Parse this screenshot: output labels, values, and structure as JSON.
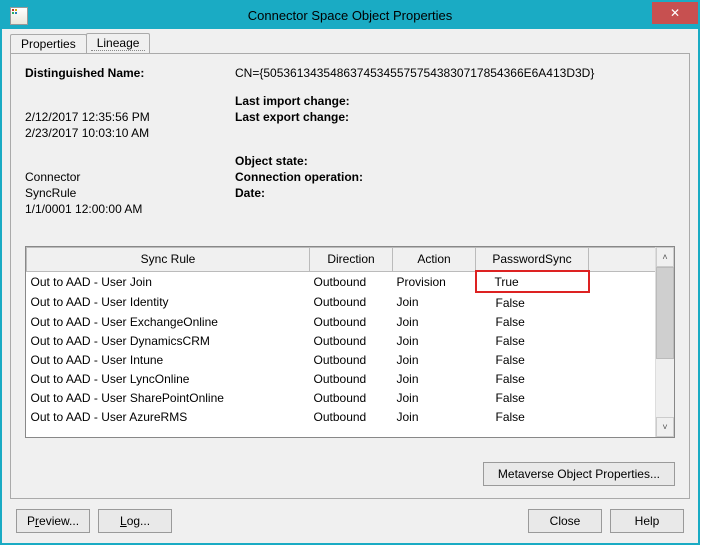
{
  "window": {
    "title": "Connector Space Object Properties",
    "close_tooltip": "Close"
  },
  "tabs": {
    "properties_label": "Properties",
    "lineage_label": "Lineage",
    "active": "lineage"
  },
  "fields": {
    "dn_label": "Distinguished Name:",
    "dn_value": "CN={505361343548637453455757543830717854366E6A413D3D}",
    "last_import_label": "Last import change:",
    "last_import_value": "2/12/2017 12:35:56 PM",
    "last_export_label": "Last export change:",
    "last_export_value": "2/23/2017 10:03:10 AM",
    "object_state_label": "Object state:",
    "object_state_value": "Connector",
    "conn_op_label": "Connection operation:",
    "conn_op_value": "SyncRule",
    "date_label": "Date:",
    "date_value": "1/1/0001 12:00:00 AM"
  },
  "table": {
    "columns": {
      "sync_rule": "Sync Rule",
      "direction": "Direction",
      "action": "Action",
      "password_sync": "PasswordSync"
    },
    "rows": [
      {
        "rule": "Out to AAD - User Join",
        "dir": "Outbound",
        "action": "Provision",
        "pw": "True",
        "hl": true
      },
      {
        "rule": "Out to AAD - User Identity",
        "dir": "Outbound",
        "action": "Join",
        "pw": "False",
        "hl": false
      },
      {
        "rule": "Out to AAD - User ExchangeOnline",
        "dir": "Outbound",
        "action": "Join",
        "pw": "False",
        "hl": false
      },
      {
        "rule": "Out to AAD - User DynamicsCRM",
        "dir": "Outbound",
        "action": "Join",
        "pw": "False",
        "hl": false
      },
      {
        "rule": "Out to AAD - User Intune",
        "dir": "Outbound",
        "action": "Join",
        "pw": "False",
        "hl": false
      },
      {
        "rule": "Out to AAD - User LyncOnline",
        "dir": "Outbound",
        "action": "Join",
        "pw": "False",
        "hl": false
      },
      {
        "rule": "Out to AAD - User SharePointOnline",
        "dir": "Outbound",
        "action": "Join",
        "pw": "False",
        "hl": false
      },
      {
        "rule": "Out to AAD - User AzureRMS",
        "dir": "Outbound",
        "action": "Join",
        "pw": "False",
        "hl": false
      }
    ]
  },
  "buttons": {
    "metaverse": "Metaverse Object Properties...",
    "preview_pre": "P",
    "preview_mn": "r",
    "preview_post": "eview...",
    "log_pre": "",
    "log_mn": "L",
    "log_post": "og...",
    "close": "Close",
    "help": "Help"
  }
}
